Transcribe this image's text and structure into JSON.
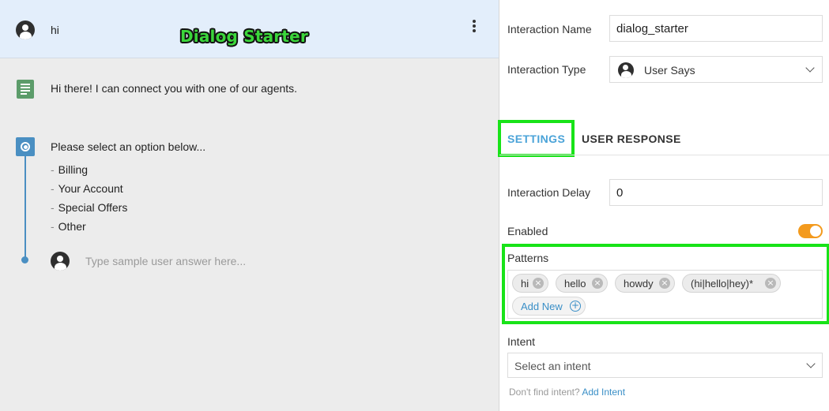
{
  "header": {
    "avatar_icon": "user-avatar-icon",
    "name": "hi",
    "overlay_title": "Dialog Starter",
    "menu_icon": "kebab-menu-icon"
  },
  "conversation": {
    "bot_message_icon": "document-icon",
    "bot_message": "Hi there! I can connect you with one of our agents.",
    "options_icon": "radio-options-icon",
    "options_prompt": "Please select an option below...",
    "options": [
      "Billing",
      "Your Account",
      "Special Offers",
      "Other"
    ],
    "user_answer_placeholder": "Type sample user answer here..."
  },
  "panel": {
    "interaction_name_label": "Interaction Name",
    "interaction_name_value": "dialog_starter",
    "interaction_type_label": "Interaction Type",
    "interaction_type_value": "User Says",
    "tabs": [
      {
        "label": "SETTINGS",
        "active": true
      },
      {
        "label": "USER RESPONSE",
        "active": false
      }
    ],
    "interaction_delay_label": "Interaction Delay",
    "interaction_delay_value": "0",
    "enabled_label": "Enabled",
    "enabled": true,
    "patterns_label": "Patterns",
    "patterns": [
      "hi",
      "hello",
      "howdy",
      "(hi|hello|hey)*"
    ],
    "add_new_label": "Add New",
    "intent_label": "Intent",
    "intent_placeholder": "Select an intent",
    "footnote_text": "Don't find intent?",
    "footnote_link": "Add Intent"
  },
  "colors": {
    "accent_blue": "#4aa3d8",
    "toggle_on": "#f39a1d",
    "highlight_green": "#18e318",
    "header_bg": "#e3eefb"
  }
}
